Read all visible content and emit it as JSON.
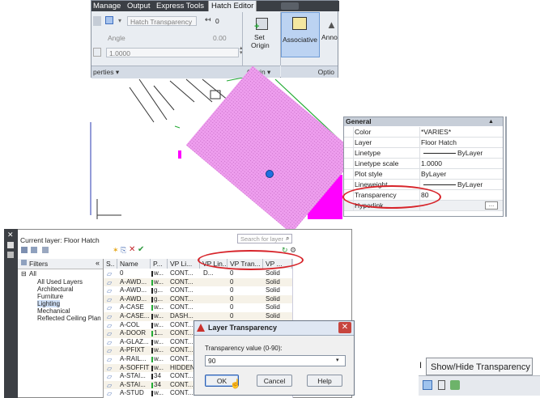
{
  "ribbon": {
    "tabs": [
      "Manage",
      "Output",
      "Express Tools",
      "Hatch Editor"
    ],
    "hatch_transparency_label": "Hatch Transparency",
    "transparency_value": "0",
    "angle_label": "Angle",
    "angle_value": "0.00",
    "scale_value": "1.0000",
    "set_origin_line1": "Set",
    "set_origin_line2": "Origin",
    "associative_label": "Associative",
    "annotative_label": "Anno",
    "panel_properties": "perties",
    "panel_origin": "Origin",
    "panel_options": "Optio"
  },
  "properties": {
    "section": "General",
    "rows": [
      {
        "key": "Color",
        "value": "*VARIES*"
      },
      {
        "key": "Layer",
        "value": "Floor Hatch"
      },
      {
        "key": "Linetype",
        "value": "ByLayer"
      },
      {
        "key": "Linetype scale",
        "value": "1.0000"
      },
      {
        "key": "Plot style",
        "value": "ByLayer"
      },
      {
        "key": "Lineweight",
        "value": "ByLayer"
      },
      {
        "key": "Transparency",
        "value": "80"
      },
      {
        "key": "Hyperlink",
        "value": ""
      }
    ]
  },
  "layer_manager": {
    "current_layer": "Current layer: Floor Hatch",
    "search_placeholder": "Search for layer",
    "filters_label": "Filters",
    "tree": [
      "All",
      "All Used Layers",
      "Architectural",
      "Furniture",
      "Lighting",
      "Mechanical",
      "Reflected Ceiling Plan"
    ],
    "columns": [
      "S..",
      "Name",
      "P...",
      "VP Li...",
      "VP Lin...",
      "VP Tran...",
      "VP ..."
    ],
    "rows": [
      {
        "name": "0",
        "p": "w...",
        "vpli": "CONT...",
        "vplin": "D...",
        "vptran": "0",
        "vp": "Solid"
      },
      {
        "name": "A-AWD...",
        "p": "w...",
        "vpli": "CONT...",
        "vplin": "",
        "vptran": "0",
        "vp": "Solid"
      },
      {
        "name": "A-AWD...",
        "p": "g...",
        "vpli": "CONT...",
        "vplin": "",
        "vptran": "0",
        "vp": "Solid"
      },
      {
        "name": "A-AWD...",
        "p": "g...",
        "vpli": "CONT...",
        "vplin": "",
        "vptran": "0",
        "vp": "Solid"
      },
      {
        "name": "A-CASE",
        "p": "w...",
        "vpli": "CONT...",
        "vplin": "",
        "vptran": "0",
        "vp": "Solid"
      },
      {
        "name": "A-CASE...",
        "p": "w...",
        "vpli": "DASH...",
        "vplin": "",
        "vptran": "0",
        "vp": "Solid"
      },
      {
        "name": "A-COL",
        "p": "w...",
        "vpli": "CONT...",
        "vplin": "",
        "vptran": "0",
        "vp": "Solid"
      },
      {
        "name": "A-DOOR",
        "p": "1...",
        "vpli": "CONT...",
        "vplin": "",
        "vptran": "0",
        "vp": "Solid"
      },
      {
        "name": "A-GLAZ...",
        "p": "w...",
        "vpli": "CONT...",
        "vplin": "",
        "vptran": "",
        "vp": ""
      },
      {
        "name": "A-PFIXT",
        "p": "w...",
        "vpli": "CONT...",
        "vplin": "",
        "vptran": "",
        "vp": ""
      },
      {
        "name": "A-RAIL...",
        "p": "w...",
        "vpli": "CONT...",
        "vplin": "",
        "vptran": "",
        "vp": ""
      },
      {
        "name": "A-SOFFIT",
        "p": "w...",
        "vpli": "HIDDEN",
        "vplin": "",
        "vptran": "",
        "vp": ""
      },
      {
        "name": "A-STAI...",
        "p": "34",
        "vpli": "CONT...",
        "vplin": "",
        "vptran": "",
        "vp": ""
      },
      {
        "name": "A-STAI...",
        "p": "34",
        "vpli": "CONT...",
        "vplin": "",
        "vptran": "",
        "vp": ""
      },
      {
        "name": "A-STUD",
        "p": "w...",
        "vpli": "CONT...",
        "vplin": "",
        "vptran": "",
        "vp": ""
      }
    ]
  },
  "dialog": {
    "title": "Layer Transparency",
    "field_label": "Transparency value (0-90):",
    "field_value": "90",
    "ok": "OK",
    "cancel": "Cancel",
    "help": "Help"
  },
  "status": {
    "tooltip": "Show/Hide Transparency"
  },
  "colors": {
    "hatch": "#ee9eee",
    "magenta": "#ff00ff",
    "highlight": "#d7242a",
    "accent_green": "#22aa33",
    "grip_blue": "#1f6fe0"
  }
}
